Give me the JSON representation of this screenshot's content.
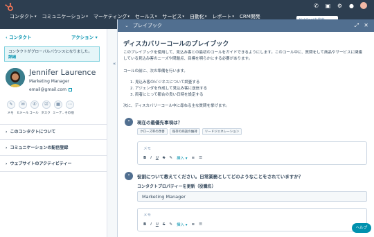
{
  "nav": {
    "items": [
      "コンタクト",
      "コミュニケーション",
      "マーケティング",
      "セールス",
      "サービス",
      "自動化",
      "レポート",
      "CRM開発"
    ],
    "search_placeholder": "HubSpotを検索"
  },
  "contact": {
    "breadcrumb": "コンタクト",
    "actions_label": "アクション",
    "alert_text": "コンタクトがグローバルバウンスになりました。",
    "alert_link": "詳細",
    "name": "Jennifer Laurence",
    "job_title": "Marketing Manager",
    "email": "email@gmail.com",
    "activity_buttons": [
      "メモ",
      "Eメール",
      "コール",
      "タスク",
      "ミーテ..",
      "その他"
    ],
    "sections": [
      "このコンタクトについて",
      "コミュニケーションの配信登録",
      "ウェブサイトのアクティビティー"
    ]
  },
  "playbook": {
    "header_label": "プレイブック",
    "title": "ディスカバリーコールのプレイブック",
    "intro": "このプレイブックを使用して、見込み客との最初のコールをガイドできるようにします。このコール中に、質問をして商品やサービスに関連している見込み客のニーズや問題点、目標を明らかにする必要があります。",
    "before_call": "コールの前に、次の準備を行います。",
    "prep_items": [
      "1. 見込み客のビジネスについて調査する",
      "2. アジェンダを作成して見込み客に送信する",
      "3. 両者にとって都合の良い日時を設定する"
    ],
    "next_text": "次に、ディスカバリーコール中に尋ねる主な質問を挙げます。",
    "q1": {
      "title": "現在の最優先事項は？",
      "tags": [
        "クローズ率の改善",
        "既存の商談の維持",
        "リードジェネレーション"
      ],
      "note_placeholder": "メモ",
      "insert_label": "挿入"
    },
    "q2": {
      "title": "役割について教えてください。日常業務としてどのようなことをされていますか？",
      "property_label": "コンタクトプロパティーを更新（役職名）",
      "property_value": "Marketing Manager",
      "note_placeholder": "メモ",
      "insert_label": "挿入"
    },
    "help_label": "ヘルプ"
  }
}
